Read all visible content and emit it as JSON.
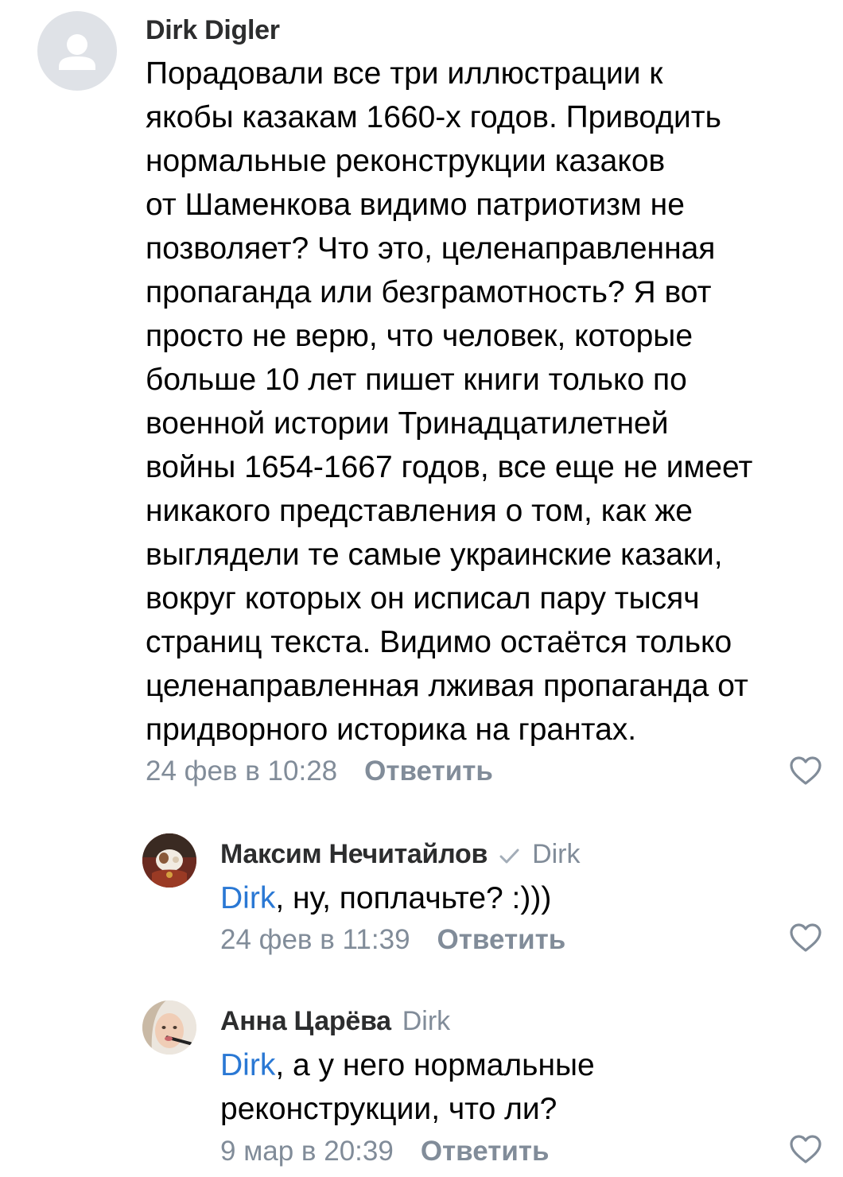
{
  "comments": [
    {
      "author": "Dirk Digler",
      "avatar_icon": "default-user-avatar-icon",
      "text_lines": [
        "Порадовали все три иллюстрации к",
        "якобы казакам 1660-х годов. Приводить",
        "нормальные реконструкции казаков",
        "от Шаменкова видимо патриотизм не",
        "позволяет? Что это, целенаправленная",
        "пропаганда или безграмотность? Я вот",
        "просто не верю, что человек, которые",
        "больше 10 лет пишет книги только по",
        "военной истории Тринадцатилетней",
        "войны 1654-1667 годов, все еще не имеет",
        "никакого представления о том, как же",
        "выглядели те самые украинские казаки,",
        "вокруг которых он исписал пару тысяч",
        "страниц текста. Видимо остаётся только",
        "целенаправленная лживая пропаганда от",
        "придворного историка на грантах."
      ],
      "date": "24 фев в 10:28",
      "reply_label": "Ответить",
      "like_icon": "heart-outline-icon"
    },
    {
      "author": "Максим Нечитайлов",
      "verified_icon": "checkmark-icon",
      "reply_to": "Dirk",
      "mention": "Dirk",
      "text_rest": ", ну, поплачьте? :)))",
      "date": "24 фев в 11:39",
      "reply_label": "Ответить",
      "like_icon": "heart-outline-icon"
    },
    {
      "author": "Анна Царёва",
      "reply_to": "Dirk",
      "mention": "Dirk",
      "text_rest": ", а у него нормальные",
      "text_line2": "реконструкции, что ли?",
      "date": "9 мар в 20:39",
      "reply_label": "Ответить",
      "like_icon": "heart-outline-icon"
    }
  ],
  "colors": {
    "mention": "#2a78d4",
    "secondary": "#818c99",
    "author": "#2c2d2e",
    "avatar_placeholder": "#dfe2e7"
  }
}
